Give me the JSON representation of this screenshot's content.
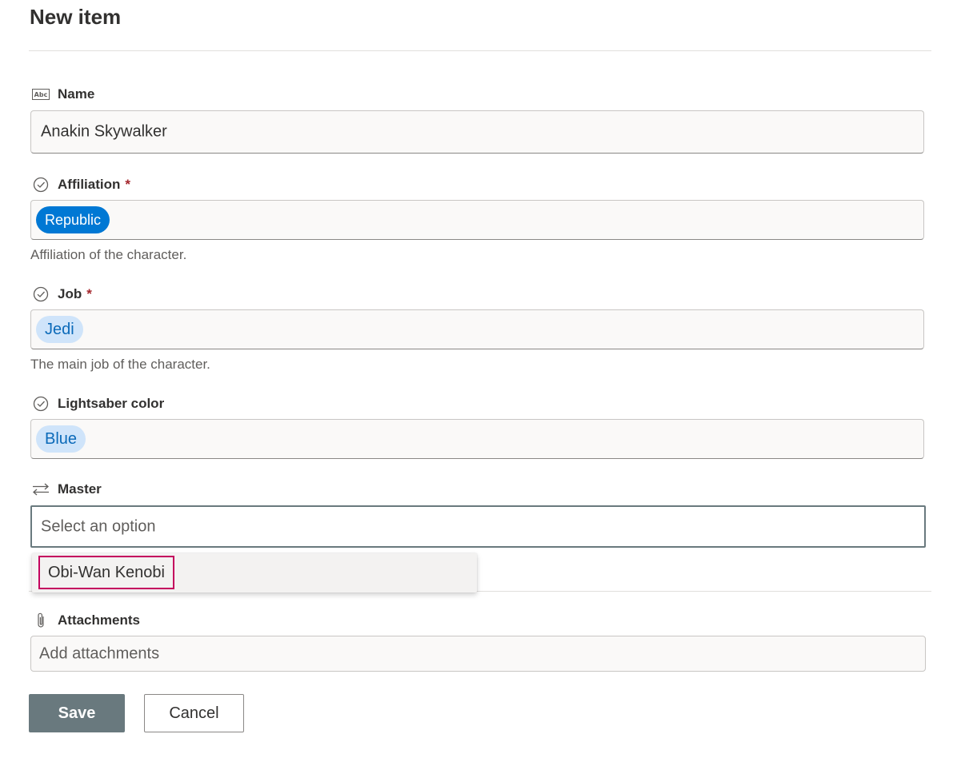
{
  "form": {
    "title": "New item",
    "fields": {
      "name": {
        "label": "Name",
        "icon": "text-field-icon",
        "value": "Anakin Skywalker"
      },
      "affiliation": {
        "label": "Affiliation",
        "required": "*",
        "icon": "choice-check-icon",
        "value": "Republic",
        "description": "Affiliation of the character."
      },
      "job": {
        "label": "Job",
        "required": "*",
        "icon": "choice-check-icon",
        "value": "Jedi",
        "description": "The main job of the character."
      },
      "lightsaber_color": {
        "label": "Lightsaber color",
        "icon": "choice-check-icon",
        "value": "Blue"
      },
      "master": {
        "label": "Master",
        "icon": "lookup-arrows-icon",
        "placeholder": "Select an option",
        "options": [
          "Obi-Wan Kenobi"
        ]
      },
      "attachments": {
        "label": "Attachments",
        "icon": "paperclip-icon",
        "placeholder": "Add attachments"
      }
    },
    "buttons": {
      "save": "Save",
      "cancel": "Cancel"
    }
  },
  "colors": {
    "accent": "#0078d4",
    "chip_soft_bg": "#cfe4fa",
    "chip_soft_text": "#0b6ab9",
    "required": "#a4262c",
    "focus_border": "#69797e",
    "highlight_border": "#c4005e",
    "save_button": "#69797e"
  }
}
